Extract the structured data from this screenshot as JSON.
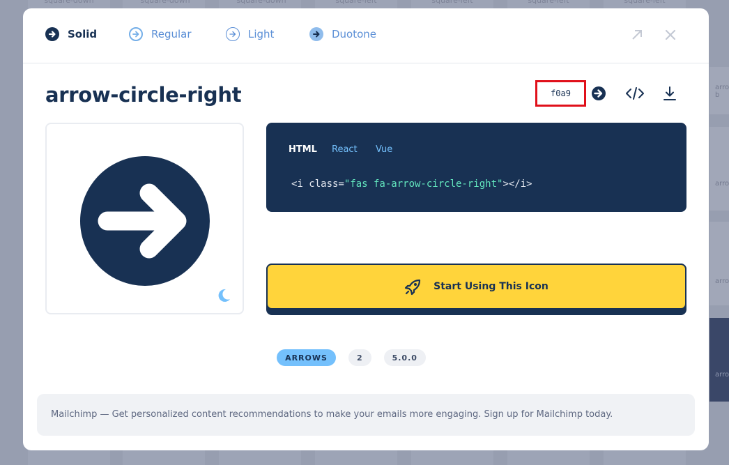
{
  "background": {
    "top_labels": [
      "square-down",
      "square-down",
      "square-down",
      "square-left",
      "square-left",
      "square-left",
      "square-left"
    ],
    "right_labels": [
      "arro",
      "b",
      "arro",
      "arro",
      "arro"
    ]
  },
  "tabs": [
    {
      "label": "Solid",
      "active": true
    },
    {
      "label": "Regular",
      "active": false
    },
    {
      "label": "Light",
      "active": false
    },
    {
      "label": "Duotone",
      "active": false
    }
  ],
  "header_icons": [
    "expand-icon",
    "close-icon"
  ],
  "icon": {
    "name": "arrow-circle-right",
    "unicode": "f0a9",
    "category": "ARROWS",
    "count": "2",
    "version": "5.0.0"
  },
  "code": {
    "tabs": [
      "HTML",
      "React",
      "Vue"
    ],
    "active_tab": "HTML",
    "snippet_open": "<i class=",
    "snippet_class": "\"fas fa-arrow-circle-right\"",
    "snippet_close": "></i>"
  },
  "cta": {
    "label": "Start Using This Icon"
  },
  "ad": {
    "text": "Mailchimp — Get personalized content recommendations to make your emails more engaging. Sign up for Mailchimp today."
  },
  "colors": {
    "navy": "#183153",
    "yellow": "#ffd43b",
    "light_blue": "#74c0fc",
    "highlight_red": "#e0101a"
  }
}
